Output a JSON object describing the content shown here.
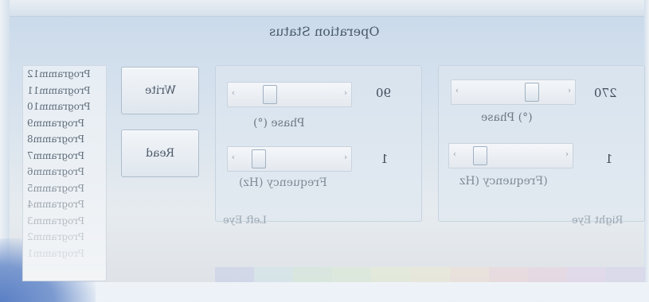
{
  "window": {
    "title": "Operation Status"
  },
  "programs": {
    "items": [
      "Programm12",
      "Programm11",
      "Programm10",
      "Programm9",
      "Programm8",
      "Programm7",
      "Programm6",
      "Programm5",
      "Programm4",
      "Programm3",
      "Programm2",
      "Programm1"
    ]
  },
  "buttons": {
    "write_label": "Write",
    "read_label": "Read"
  },
  "left_eye": {
    "group_label": "Left Eye",
    "phase_label": "Phase (°)",
    "phase_value": "90",
    "phase_level": 0.25,
    "frequency_label": "Frequency (Hz)",
    "frequency_value": "1",
    "frequency_level": 0.1
  },
  "right_eye": {
    "group_label": "Right Eye",
    "phase_label": "(°) Phase",
    "phase_value": "270",
    "phase_level": 0.75,
    "frequency_label": "(Frequency (Hz",
    "frequency_value": "1",
    "frequency_level": 0.1
  },
  "colors": {
    "accent": "#5a7fc4",
    "strip": [
      "#b9c3e8",
      "#c8e6e8",
      "#cdeccd",
      "#d9f0c9",
      "#eaf3c2",
      "#f6edc2",
      "#f8dcc6",
      "#f6cdcd",
      "#f0c6dc",
      "#e0c9ec",
      "#cdc8ee"
    ]
  }
}
